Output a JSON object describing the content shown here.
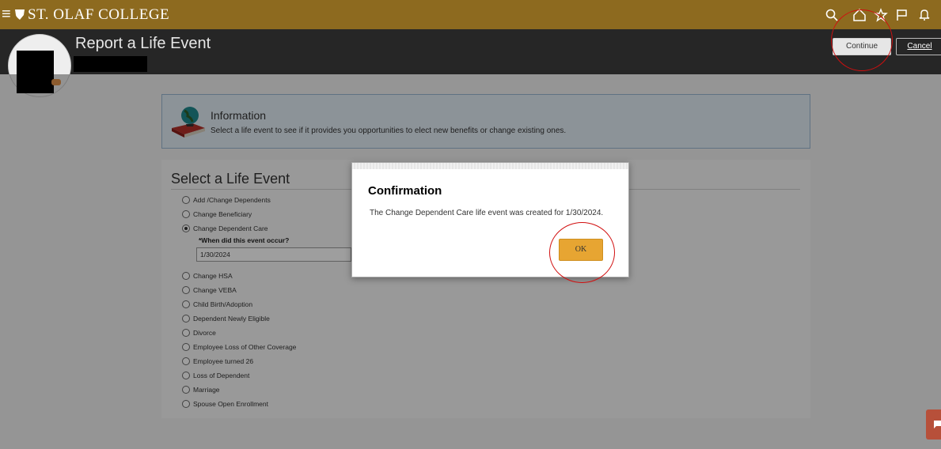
{
  "topbar": {
    "logo_text": "ST. OLAF COLLEGE",
    "icons": [
      "menu-icon",
      "search-icon",
      "home-icon",
      "star-icon",
      "flag-icon",
      "bell-icon"
    ]
  },
  "header": {
    "title": "Report a Life Event",
    "continue_label": "Continue",
    "cancel_label": "Cancel"
  },
  "info": {
    "title": "Information",
    "text": "Select a life event to see if it provides you opportunities to elect new benefits or change existing ones."
  },
  "events": {
    "title": "Select a Life Event",
    "when_label": "*When did this event occur?",
    "date_value": "1/30/2024",
    "options": [
      {
        "label": "Add /Change Dependents",
        "checked": false
      },
      {
        "label": "Change Beneficiary",
        "checked": false
      },
      {
        "label": "Change Dependent Care",
        "checked": true
      },
      {
        "label": "Change HSA",
        "checked": false
      },
      {
        "label": "Change VEBA",
        "checked": false
      },
      {
        "label": "Child Birth/Adoption",
        "checked": false
      },
      {
        "label": "Dependent Newly Eligible",
        "checked": false
      },
      {
        "label": "Divorce",
        "checked": false
      },
      {
        "label": "Employee Loss of Other Coverage",
        "checked": false
      },
      {
        "label": "Employee turned 26",
        "checked": false
      },
      {
        "label": "Loss of Dependent",
        "checked": false
      },
      {
        "label": "Marriage",
        "checked": false
      },
      {
        "label": "Spouse Open Enrollment",
        "checked": false
      }
    ]
  },
  "dialog": {
    "title": "Confirmation",
    "message": "The Change Dependent Care life event was created for 1/30/2024.",
    "ok_label": "OK"
  },
  "colors": {
    "topbar": "#8d6a1f",
    "header": "#262626",
    "ok_button": "#e7a532",
    "annotation": "#d10f0f"
  }
}
